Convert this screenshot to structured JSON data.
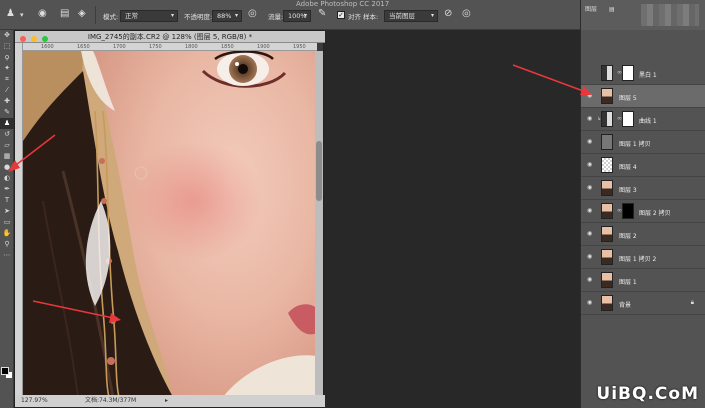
{
  "app": {
    "title": "Adobe Photoshop CC 2017"
  },
  "options_bar": {
    "mode_label": "模式:",
    "mode_value": "正常",
    "opacity_label": "不透明度:",
    "opacity_value": "88%",
    "flow_label": "流量:",
    "flow_value": "100%",
    "aligned_label": "对齐",
    "sample_label": "样本:",
    "sample_value": "当前图层"
  },
  "document": {
    "title": "IMG_2745的副本.CR2 @ 128% (图层 5, RGB/8) *",
    "ruler_ticks": [
      "1600",
      "1650",
      "1700",
      "1750",
      "1800",
      "1850",
      "1900",
      "1950"
    ],
    "zoom": "127.97%",
    "doc_size": "文档:74.3M/377M"
  },
  "layers_panel": {
    "tab_label": "图层",
    "layers": [
      {
        "name": "黑白 1",
        "type": "adjustment",
        "visible": false,
        "selected": false
      },
      {
        "name": "图层 5",
        "type": "photo",
        "visible": true,
        "selected": true
      },
      {
        "name": "曲线 1",
        "type": "adjustment",
        "visible": true,
        "selected": false,
        "clipped": true
      },
      {
        "name": "图层 1 拷贝",
        "type": "gray",
        "visible": true,
        "selected": false
      },
      {
        "name": "图层 4",
        "type": "checker",
        "visible": true,
        "selected": false
      },
      {
        "name": "图层 3",
        "type": "photo",
        "visible": true,
        "selected": false
      },
      {
        "name": "图层 2 拷贝",
        "type": "photo-mask",
        "visible": true,
        "selected": false
      },
      {
        "name": "图层 2",
        "type": "photo",
        "visible": true,
        "selected": false
      },
      {
        "name": "图层 1 拷贝 2",
        "type": "photo",
        "visible": true,
        "selected": false
      },
      {
        "name": "图层 1",
        "type": "photo",
        "visible": true,
        "selected": false
      },
      {
        "name": "背景",
        "type": "photo",
        "visible": true,
        "selected": false,
        "locked": true
      }
    ]
  },
  "watermark": "UiBQ.CoM",
  "colors": {
    "annotation_arrow": "#e8383b",
    "panel_bg": "#535353",
    "selected_layer_bg": "#6b6b6b"
  }
}
